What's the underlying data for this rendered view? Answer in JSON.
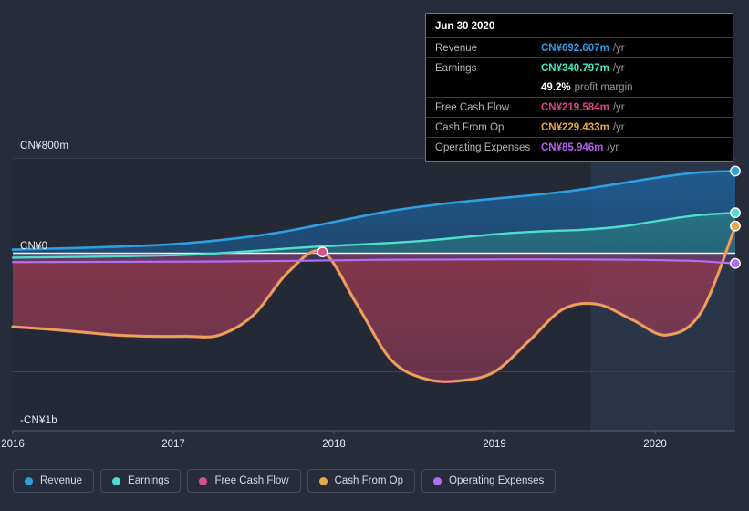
{
  "chart_data": {
    "type": "area",
    "title": "",
    "xlabel": "",
    "ylabel": "",
    "currency_prefix": "CN¥",
    "y_ticks": [
      "CN¥800m",
      "CN¥0",
      "-CN¥1b"
    ],
    "ylim": [
      -1000,
      800
    ],
    "grid": true,
    "legend_position": "bottom-left",
    "x_tick_labels": [
      "2016",
      "2017",
      "2018",
      "2019",
      "2020"
    ],
    "x_range": [
      "2016",
      "2020.5"
    ],
    "forecast_band_start": "2019.6",
    "series": [
      {
        "name": "Revenue",
        "color": "#2e9fe0",
        "values": [
          30,
          38,
          47,
          58,
          72,
          96,
          130,
          175,
          235,
          300,
          360,
          404,
          440,
          470,
          500,
          540,
          590,
          640,
          680,
          692.607
        ]
      },
      {
        "name": "Earnings",
        "color": "#4fdecb",
        "values": [
          -38,
          -34,
          -30,
          -25,
          -19,
          -8,
          12,
          34,
          55,
          72,
          88,
          110,
          140,
          168,
          186,
          198,
          225,
          275,
          320,
          340.797
        ]
      },
      {
        "name": "Free Cash Flow",
        "color": "#d6518a",
        "values": [
          -620,
          -640,
          -665,
          -690,
          -700,
          -700,
          -690,
          -520,
          -160,
          10,
          -430,
          -900,
          -1060,
          -1075,
          -1000,
          -740,
          -470,
          -430,
          -560,
          -690,
          -500,
          219.584
        ]
      },
      {
        "name": "Cash From Op",
        "color": "#e6a84f",
        "values": [
          -620,
          -640,
          -665,
          -690,
          -700,
          -700,
          -690,
          -520,
          -160,
          14,
          -430,
          -900,
          -1060,
          -1075,
          -1000,
          -740,
          -470,
          -430,
          -560,
          -690,
          -500,
          229.433
        ]
      },
      {
        "name": "Operating Expenses",
        "color": "#b46ef0",
        "values": [
          -75,
          -74,
          -73,
          -72,
          -71,
          -70,
          -68,
          -66,
          -62,
          -58,
          -55,
          -54,
          -53,
          -52,
          -52,
          -53,
          -55,
          -58,
          -66,
          -85.946
        ]
      }
    ]
  },
  "tooltip": {
    "title": "Jun 30 2020",
    "rows": [
      {
        "label": "Revenue",
        "value": "CN¥692.607m",
        "unit": "/yr",
        "color": "#2d9ce8"
      },
      {
        "label": "Earnings",
        "value": "CN¥340.797m",
        "unit": "/yr",
        "color": "#3ee8c0"
      },
      {
        "label": "",
        "value": "49.2%",
        "unit": "profit margin",
        "color": "#ffffff"
      },
      {
        "label": "Free Cash Flow",
        "value": "CN¥219.584m",
        "unit": "/yr",
        "color": "#e0418a"
      },
      {
        "label": "Cash From Op",
        "value": "CN¥229.433m",
        "unit": "/yr",
        "color": "#e8a63c"
      },
      {
        "label": "Operating Expenses",
        "value": "CN¥85.946m",
        "unit": "/yr",
        "color": "#b45cf0"
      }
    ]
  },
  "legend": {
    "items": [
      {
        "label": "Revenue",
        "color": "#2e9fe0"
      },
      {
        "label": "Earnings",
        "color": "#4fdecb"
      },
      {
        "label": "Free Cash Flow",
        "color": "#d6518a"
      },
      {
        "label": "Cash From Op",
        "color": "#e6a84f"
      },
      {
        "label": "Operating Expenses",
        "color": "#b46ef0"
      }
    ]
  },
  "axes": {
    "y_top": "CN¥800m",
    "y_zero": "CN¥0",
    "y_bottom": "-CN¥1b",
    "x": [
      "2016",
      "2017",
      "2018",
      "2019",
      "2020"
    ]
  },
  "colors": {
    "background": "#272c3a",
    "plot_background": "#242936",
    "gridline": "#4a5060",
    "zero_line": "#ffffff",
    "negative_fill": "#8e3b48"
  }
}
